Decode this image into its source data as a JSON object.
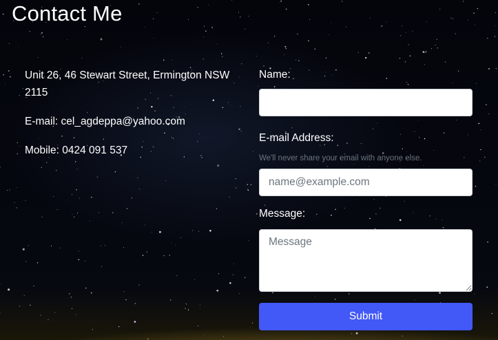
{
  "page": {
    "title": "Contact Me"
  },
  "contact": {
    "address": "Unit 26, 46 Stewart Street, Ermington NSW 2115",
    "email": "E-mail: cel_agdeppa@yahoo.com",
    "mobile": "Mobile: 0424 091 537"
  },
  "form": {
    "name_label": "Name:",
    "name_value": "",
    "email_label": "E-mail Address:",
    "email_help": "We'll never share your email with anyone else.",
    "email_placeholder": "name@example.com",
    "message_label": "Message:",
    "message_placeholder": "Message",
    "submit_label": "Submit"
  },
  "colors": {
    "submit_button": "#4258f7",
    "background": "#03040a",
    "text": "#ffffff",
    "help_text": "#6c757d"
  }
}
